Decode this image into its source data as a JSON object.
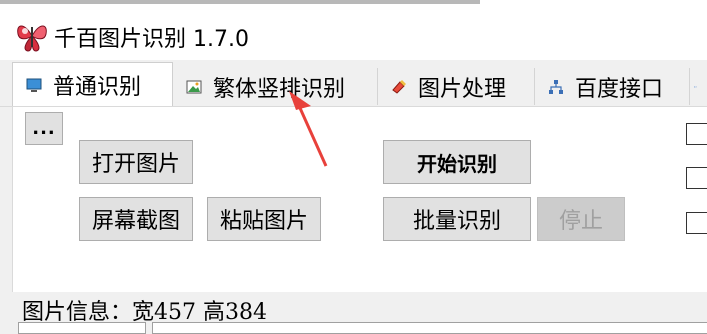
{
  "window": {
    "title": "千百图片识别 1.7.0",
    "app_icon": "butterfly-icon"
  },
  "tabs": [
    {
      "label": "普通识别",
      "icon": "monitor-icon",
      "active": true
    },
    {
      "label": "繁体竖排识别",
      "icon": "image-icon",
      "active": false
    },
    {
      "label": "图片处理",
      "icon": "paint-icon",
      "active": false
    },
    {
      "label": "百度接口",
      "icon": "network-icon",
      "active": false
    }
  ],
  "buttons": {
    "more": "...",
    "open_image": "打开图片",
    "start_recognition": "开始识别",
    "screenshot": "屏幕截图",
    "paste_image": "粘贴图片",
    "batch_recognition": "批量识别",
    "stop": "停止"
  },
  "status": {
    "image_info": "图片信息：宽457 高384"
  },
  "colors": {
    "annotation_arrow": "#e8413b",
    "button_bg": "#e1e1e1",
    "panel_bg": "#ffffff"
  }
}
